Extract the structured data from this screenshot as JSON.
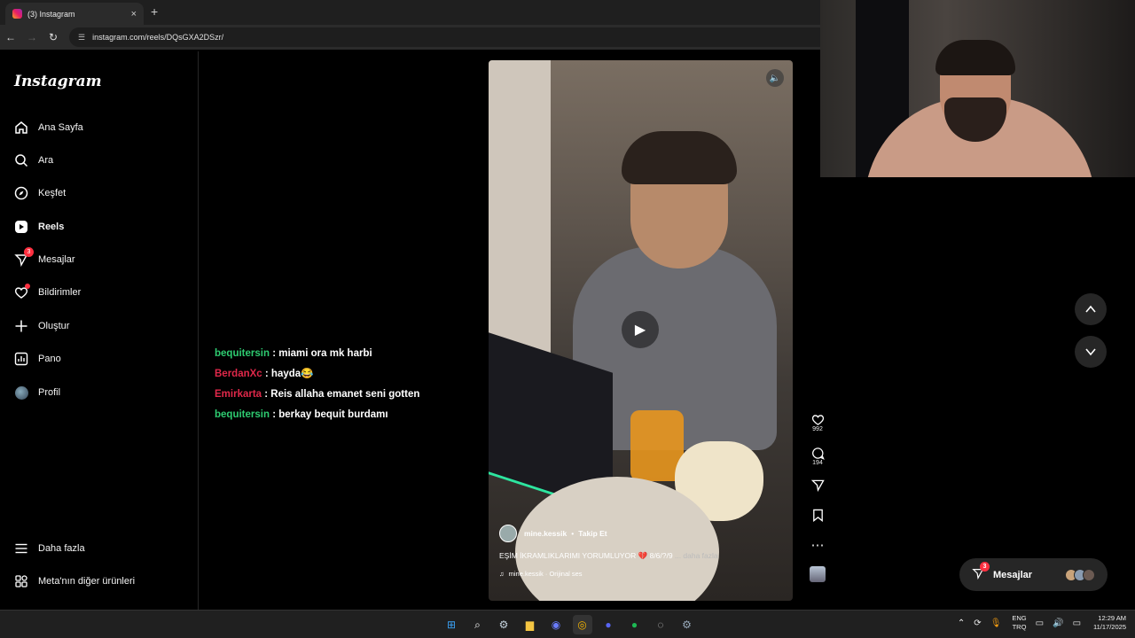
{
  "browser": {
    "tab_title": "(3) Instagram",
    "url": "instagram.com/reels/DQsGXA2DSzr/",
    "new_tab": "+",
    "close": "×"
  },
  "sidebar": {
    "logo": "Instagram",
    "items": [
      {
        "label": "Ana Sayfa",
        "icon": "home-icon"
      },
      {
        "label": "Ara",
        "icon": "search-icon"
      },
      {
        "label": "Keşfet",
        "icon": "compass-icon"
      },
      {
        "label": "Reels",
        "icon": "reels-icon"
      },
      {
        "label": "Mesajlar",
        "icon": "messenger-icon",
        "badge": "3"
      },
      {
        "label": "Bildirimler",
        "icon": "heart-icon"
      },
      {
        "label": "Oluştur",
        "icon": "plus-icon"
      },
      {
        "label": "Pano",
        "icon": "dashboard-icon"
      },
      {
        "label": "Profil",
        "icon": "avatar"
      }
    ],
    "more": "Daha fazla",
    "meta": "Meta'nın diğer ürünleri"
  },
  "chat": [
    {
      "user": "bequitersin",
      "color": "#2ecc71",
      "message": ": miami ora mk harbi"
    },
    {
      "user": "BerdanXc",
      "color": "#e0284a",
      "message": ": hayda😂"
    },
    {
      "user": "Emirkarta",
      "color": "#e0284a",
      "message": ": Reis allaha emanet seni gotten"
    },
    {
      "user": "bequitersin",
      "color": "#2ecc71",
      "message": ": berkay bequit burdamı"
    }
  ],
  "reel": {
    "username": "mine.kessik",
    "separator": "•",
    "follow": "Takip Et",
    "caption": "EŞİM İKRAMLIKLARIMI YORUMLUYOR 💔 8/6/?/9",
    "caption_more": "... daha fazla",
    "audio": "mine.kessik · Orijinal ses",
    "likes": "992",
    "comments": "194"
  },
  "messages_pill": {
    "label": "Mesajlar",
    "badge": "3"
  },
  "taskbar": {
    "lang_top": "ENG",
    "lang_bottom": "TRQ",
    "time": "12:29 AM",
    "date": "11/17/2025"
  },
  "colors": {
    "accent_red": "#ff3040",
    "chat_green": "#2ecc71",
    "chat_red": "#e0284a"
  }
}
